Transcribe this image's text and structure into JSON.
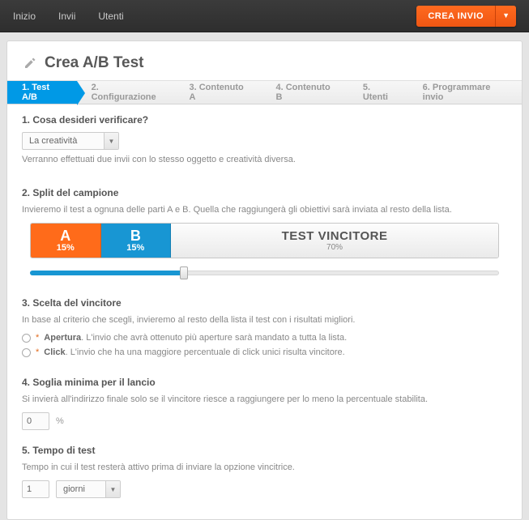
{
  "topnav": {
    "items": [
      "Inizio",
      "Invii",
      "Utenti"
    ]
  },
  "createBtn": {
    "label": "CREA INVIO"
  },
  "page": {
    "title": "Crea A/B Test"
  },
  "wizard": {
    "steps": [
      {
        "label": "1. Test A/B",
        "active": true
      },
      {
        "label": "2. Configurazione"
      },
      {
        "label": "3. Contenuto  A"
      },
      {
        "label": "4. Contenuto  B"
      },
      {
        "label": "5. Utenti"
      },
      {
        "label": "6. Programmare invio"
      }
    ]
  },
  "s1": {
    "title": "1. Cosa desideri verificare?",
    "selectValue": "La creatività",
    "desc": "Verranno effettuati due invii con lo stesso oggetto e creatività diversa."
  },
  "s2": {
    "title": "2. Split del campione",
    "desc": "Invieremo il test a ognuna delle parti A e B. Quella che raggiungerà gli obiettivi sarà inviata al resto della lista.",
    "a": {
      "letter": "A",
      "pct": "15%"
    },
    "b": {
      "letter": "B",
      "pct": "15%"
    },
    "win": {
      "title": "TEST VINCITORE",
      "pct": "70%"
    },
    "sliderPercent": 33
  },
  "s3": {
    "title": "3. Scelta del vincitore",
    "desc": "In base al criterio che scegli, invieremo al resto della lista il test con i risultati migliori.",
    "opt1": {
      "name": "Apertura",
      "desc": ". L'invio che avrà ottenuto più aperture sarà mandato a tutta la lista."
    },
    "opt2": {
      "name": "Click",
      "desc": ". L'invio che ha una maggiore percentuale di click unici risulta vincitore."
    }
  },
  "s4": {
    "title": "4. Soglia minima per il lancio",
    "desc": "Si invierà all'indirizzo finale solo se il vincitore riesce a raggiungere per lo meno la percentuale stabilita.",
    "value": "0",
    "unit": "%"
  },
  "s5": {
    "title": "5. Tempo di test",
    "desc": "Tempo in cui il test resterà attivo prima di inviare la opzione vincitrice.",
    "value": "1",
    "unitSelect": "giorni"
  }
}
